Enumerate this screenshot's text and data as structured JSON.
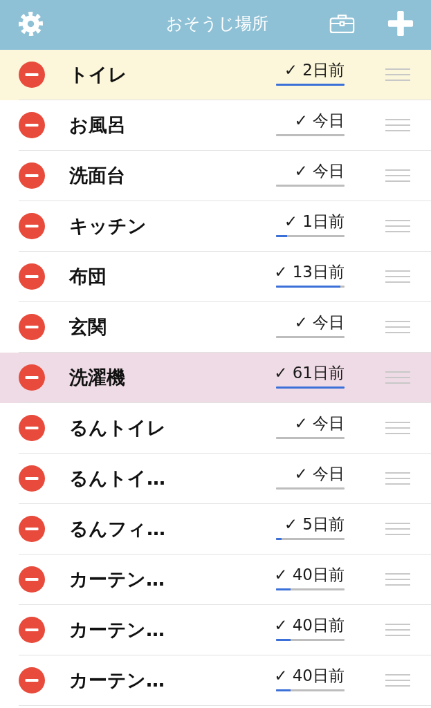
{
  "header": {
    "title": "おそうじ場所"
  },
  "places": [
    {
      "name": "トイレ",
      "status": "✓ 2日前",
      "level": 1,
      "color": "#fcf7da"
    },
    {
      "name": "お風呂",
      "status": "✓ 今日",
      "level": 0,
      "color": "#ffffff"
    },
    {
      "name": "洗面台",
      "status": "✓ 今日",
      "level": 0,
      "color": "#ffffff"
    },
    {
      "name": "キッチン",
      "status": "✓ 1日前",
      "level": 0.16,
      "color": "#ffffff"
    },
    {
      "name": "布団",
      "status": "✓ 13日前",
      "level": 0.94,
      "color": "#ffffff"
    },
    {
      "name": "玄関",
      "status": "✓ 今日",
      "level": 0,
      "color": "#ffffff"
    },
    {
      "name": "洗濯機",
      "status": "✓ 61日前",
      "level": 1,
      "color": "#efdbe5"
    },
    {
      "name": "るんトイレ",
      "status": "✓ 今日",
      "level": 0,
      "color": "#ffffff"
    },
    {
      "name": "るんトイ…",
      "status": "✓ 今日",
      "level": 0,
      "color": "#ffffff"
    },
    {
      "name": "るんフィ…",
      "status": "✓ 5日前",
      "level": 0.08,
      "color": "#ffffff"
    },
    {
      "name": "カーテン…",
      "status": "✓ 40日前",
      "level": 0.21,
      "color": "#ffffff"
    },
    {
      "name": "カーテン…",
      "status": "✓ 40日前",
      "level": 0.21,
      "color": "#ffffff"
    },
    {
      "name": "カーテン…",
      "status": "✓ 40日前",
      "level": 0.21,
      "color": "#ffffff"
    }
  ]
}
